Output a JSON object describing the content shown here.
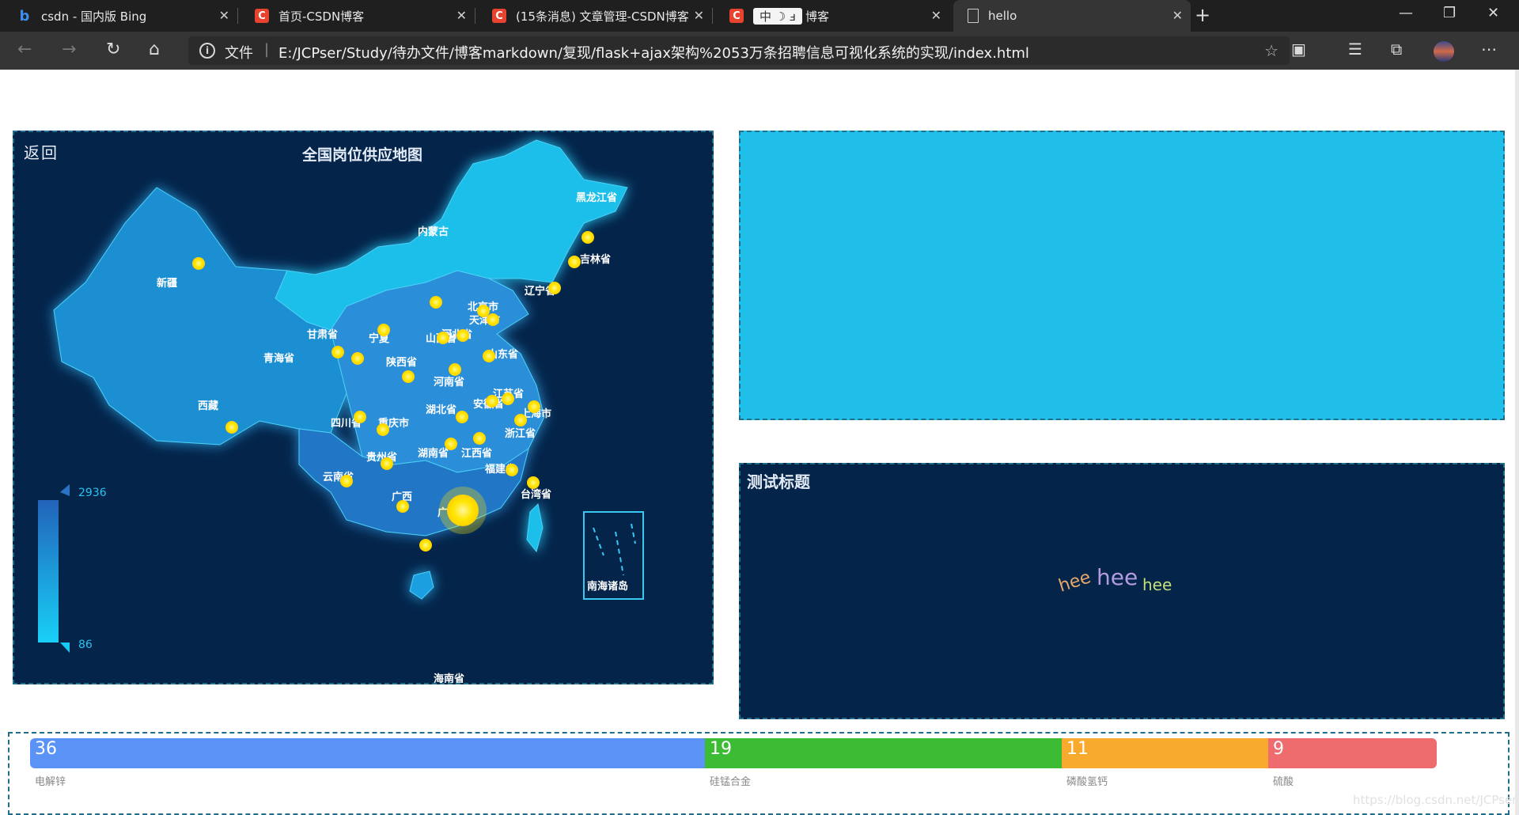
{
  "tabs": [
    {
      "label": "csdn - 国内版 Bing",
      "icon": "bing-icon",
      "color": "#1a73e8"
    },
    {
      "label": "首页-CSDN博客",
      "icon": "csdn-icon",
      "color": "#e8432e"
    },
    {
      "label": "(15条消息) 文章管理-CSDN博客",
      "icon": "csdn-icon",
      "color": "#e8432e"
    },
    {
      "label": "博客",
      "icon": "csdn-icon",
      "color": "#e8432e",
      "ime": [
        "中",
        "☽",
        "ⅎ"
      ]
    },
    {
      "label": "hello",
      "icon": "page-icon",
      "color": "#cccccc"
    }
  ],
  "address": {
    "file_label": "文件",
    "separator": "|",
    "url": "E:/JCPser/Study/待办文件/博客markdown/复现/flask+ajax架构%2053万条招聘信息可视化系统的实现/index.html"
  },
  "map": {
    "back_label": "返回",
    "title": "全国岗位供应地图",
    "visualmap": {
      "max": "2936",
      "min": "86"
    },
    "provinces": [
      "黑龙江省",
      "吉林省",
      "辽宁省",
      "内蒙古",
      "新疆",
      "甘肃省",
      "宁夏",
      "青海省",
      "陕西省",
      "山西省",
      "北京市",
      "天津市",
      "河北省",
      "山东省",
      "河南省",
      "江苏省",
      "上海市",
      "安徽省",
      "湖北省",
      "四川省",
      "重庆市",
      "西藏",
      "浙江省",
      "湖南省",
      "江西省",
      "贵州省",
      "福建省",
      "台湾省",
      "云南省",
      "广西",
      "广东省",
      "海南省",
      "南海诸岛"
    ]
  },
  "cloud": {
    "title": "测试标题",
    "words": [
      "hee",
      "hee",
      "hee"
    ]
  },
  "bar": {
    "segments": [
      {
        "value": "36",
        "label": "电解锌",
        "color": "#5a92f5"
      },
      {
        "value": "19",
        "label": "硅锰合金",
        "color": "#3cbc34"
      },
      {
        "value": "11",
        "label": "磷酸氢钙",
        "color": "#f8aa2e"
      },
      {
        "value": "9",
        "label": "硫酸",
        "color": "#ee6b6e"
      }
    ]
  },
  "watermark": "https://blog.csdn.net/JCPser",
  "colors": {
    "map_bg": "#04244a",
    "province_fill": "#1fbfea",
    "scatter": "#ffe500",
    "blue_panel": "#1fbfea"
  }
}
